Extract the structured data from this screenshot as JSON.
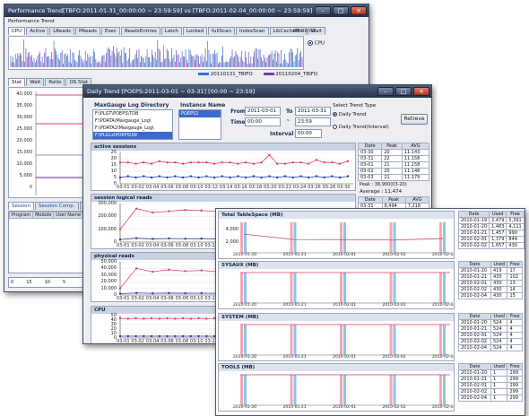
{
  "perf_window": {
    "title": "Performance Trend[TBFO:2011-01-31_00:00:00 ~ 23:59:59] vs [TBFO:2011-02-04_00:00:00 ~ 23:59:59]",
    "header_label": "Performance Trend",
    "tabs": [
      "CPU",
      "Active",
      "LReads",
      "PReads",
      "Exec",
      "ReadsEntries",
      "Latch",
      "Locked",
      "fullScan",
      "IndexScan",
      "LibCachePin",
      "Wait"
    ],
    "time_label": "00:00:00",
    "cpu_radio": "CPU",
    "legend": [
      "20110131_TBIFO",
      "20110204_TBIFO"
    ],
    "sub_tabs": [
      "Stat",
      "Wait",
      "Ratio",
      "OS Stat"
    ],
    "y_ticks": [
      "40,000",
      "35,000",
      "30,000",
      "25,000",
      "20,000",
      "15,000",
      "10,000",
      "5,000",
      "0"
    ],
    "session_tabs": [
      "Session",
      "Session Comp.",
      "Proce"
    ],
    "session_columns": [
      "Program",
      "Module",
      "User Name",
      "SPID"
    ],
    "bottom_values": [
      "0",
      "15",
      "10",
      "5"
    ]
  },
  "daily_window": {
    "title": "Daily Trend [POEPS:2011-03-01 ~ 03-31] [00:00 ~ 23:59]",
    "log_dir_label": "MaxGauge Log Directory",
    "log_dirs": [
      "F:\\PLGT\\POEPS\\TDB",
      "F:\\PDATA\\Maxgauge_Log\\",
      "F:\\PDATA2\\Maxgauge_Log\\",
      "F:\\PLGLs\\POEPS\\IW"
    ],
    "instance_label": "Instance Name",
    "instances": [
      "POEPS1"
    ],
    "from_label": "From",
    "from_date": "2011-03-01",
    "to_label": "To",
    "to_date": "2011-03-31",
    "time_label": "Time",
    "time_from": "00:00",
    "time_to": "23:59",
    "interval_label": "Interval",
    "interval_value": "00:00",
    "select_trend_label": "Select Trend Type",
    "trend_options": [
      "Daily Trend",
      "Daily Trend(Interval)"
    ],
    "retrieve_button": "Retreve",
    "charts": [
      {
        "title": "active sessions",
        "y_ticks": [
          "25",
          "20",
          "15",
          "10",
          "5",
          "0"
        ]
      },
      {
        "title": "session logical reads",
        "y_ticks": [
          "300,000",
          "200,000",
          "100,000",
          "0"
        ]
      },
      {
        "title": "physical reads",
        "y_ticks": [
          "50,000",
          "40,000",
          "30,000",
          "20,000",
          "10,000",
          "0"
        ]
      },
      {
        "title": "CPU",
        "y_ticks": [
          "50",
          "40",
          "30",
          "20",
          "10",
          "0"
        ]
      }
    ],
    "x_ticks": [
      "03-01",
      "03-02",
      "03-04",
      "03-06",
      "03-08",
      "03-10",
      "03-12",
      "03-14",
      "03-16",
      "03-18",
      "03-20",
      "03-22",
      "03-24",
      "03-26",
      "03-28",
      "03-30"
    ],
    "side_table": {
      "columns": [
        "Date",
        "Peak",
        "AVG"
      ],
      "rows": [
        [
          "03-30",
          "20",
          "11.143"
        ],
        [
          "03-31",
          "22",
          "11.158"
        ],
        [
          "03-01",
          "21",
          "11.158"
        ],
        [
          "03-02",
          "20",
          "11.148"
        ],
        [
          "03-03",
          "21",
          "11.179"
        ]
      ],
      "peak_note": "Peak : 38,900(03-20)",
      "average_note": "Average : 11,474",
      "rows2": [
        [
          "03-31",
          "8,494",
          "7,218"
        ]
      ]
    }
  },
  "tablespace_window": {
    "sections": [
      {
        "title": "Total TableSpace (MB)",
        "y_ticks": [
          "4,000",
          "2,000"
        ],
        "columns": [
          "Date",
          "Used",
          "Free"
        ],
        "rows": [
          [
            "2010-01-19",
            "2,479",
            "5,391"
          ],
          [
            "2010-01-20",
            "1,483",
            "4,111"
          ],
          [
            "2010-01-21",
            "1,457",
            "990"
          ],
          [
            "2010-02-01",
            "1,379",
            "849"
          ],
          [
            "2010-02-02",
            "1,657",
            "430"
          ]
        ]
      },
      {
        "title": "SYSAUX (MB)",
        "y_ticks": [],
        "columns": [
          "Date",
          "Used",
          "Free"
        ],
        "rows": [
          [
            "2010-01-20",
            "419",
            "17"
          ],
          [
            "2010-01-21",
            "430",
            "102"
          ],
          [
            "2010-02-01",
            "430",
            "13"
          ],
          [
            "2010-02-02",
            "430",
            "14"
          ],
          [
            "2010-02-04",
            "430",
            "15"
          ]
        ]
      },
      {
        "title": "SYSTEM (MB)",
        "y_ticks": [],
        "columns": [
          "Date",
          "Used",
          "Free"
        ],
        "rows": [
          [
            "2010-01-20",
            "524",
            "4"
          ],
          [
            "2010-01-21",
            "524",
            "4"
          ],
          [
            "2010-02-01",
            "524",
            "4"
          ],
          [
            "2010-02-02",
            "524",
            "4"
          ],
          [
            "2010-02-04",
            "524",
            "4"
          ]
        ]
      },
      {
        "title": "TOOLS (MB)",
        "y_ticks": [],
        "columns": [
          "Date",
          "Used",
          "Free"
        ],
        "rows": [
          [
            "2010-01-20",
            "1",
            "299"
          ],
          [
            "2010-01-21",
            "1",
            "299"
          ],
          [
            "2010-02-01",
            "1",
            "299"
          ],
          [
            "2010-02-02",
            "1",
            "299"
          ],
          [
            "2010-02-04",
            "1",
            "299"
          ]
        ]
      }
    ],
    "x_ticks": [
      "2010-01-20",
      "2010-01-21",
      "2010-02-01",
      "2010-02-02",
      "2010-02-04"
    ]
  },
  "colors": {
    "pink_series": "#e0406a",
    "blue_series": "#2838a0",
    "purple_series": "#5a2a9a",
    "bar_blue": "#8fc4ea",
    "bar_pink": "#f0a8b8",
    "titlebar": "#2e3b55"
  },
  "chart_data": [
    {
      "type": "line",
      "title": "active sessions",
      "x": [
        "03-01",
        "03-02",
        "03-03",
        "03-04",
        "03-05",
        "03-06",
        "03-07",
        "03-08",
        "03-09",
        "03-10",
        "03-11",
        "03-12",
        "03-13",
        "03-14",
        "03-15",
        "03-16",
        "03-17",
        "03-18",
        "03-19",
        "03-20",
        "03-21",
        "03-22",
        "03-23",
        "03-24",
        "03-25",
        "03-26",
        "03-27",
        "03-28",
        "03-29",
        "03-30"
      ],
      "series": [
        {
          "values": [
            17,
            17,
            16,
            17,
            16,
            18,
            17,
            17,
            16,
            17,
            17,
            17,
            16,
            17,
            17,
            16,
            17,
            16,
            17,
            23,
            16,
            16,
            17,
            17,
            16,
            19,
            17,
            17,
            16,
            18
          ]
        },
        {
          "values": [
            5,
            6,
            5,
            6,
            5,
            6,
            5,
            6,
            5,
            6,
            5,
            6,
            5,
            6,
            5,
            6,
            5,
            6,
            5,
            6,
            5,
            6,
            5,
            6,
            5,
            6,
            5,
            6,
            5,
            6
          ]
        }
      ],
      "ylim": [
        0,
        25
      ]
    },
    {
      "type": "line",
      "title": "session logical reads",
      "x": [
        "03-01",
        "03-02",
        "03-03",
        "03-04",
        "03-05",
        "03-06",
        "03-07",
        "03-08",
        "03-09",
        "03-10",
        "03-11",
        "03-12",
        "03-13",
        "03-14",
        "03-15"
      ],
      "series": [
        {
          "values": [
            100000,
            260000,
            230000,
            240000,
            250000,
            245000,
            240000,
            250000,
            240000,
            245000,
            240000,
            250000,
            245000,
            240000,
            250000
          ]
        },
        {
          "values": [
            20000,
            30000,
            25000,
            28000,
            26000,
            27000,
            25000,
            28000,
            26000,
            27000,
            25000,
            28000,
            26000,
            27000,
            25000
          ]
        }
      ],
      "ylim": [
        0,
        300000
      ]
    },
    {
      "type": "line",
      "title": "physical reads",
      "x": [
        "03-01",
        "03-02",
        "03-03",
        "03-04",
        "03-05",
        "03-06",
        "03-07",
        "03-08",
        "03-09",
        "03-10",
        "03-11",
        "03-12",
        "03-13",
        "03-14",
        "03-15"
      ],
      "series": [
        {
          "values": [
            10000,
            40000,
            35000,
            38000,
            36000,
            37000,
            35000,
            39000,
            36000,
            37000,
            35000,
            38000,
            36000,
            37000,
            35000
          ]
        },
        {
          "values": [
            2000,
            3000,
            2500,
            2800,
            2600,
            2700,
            2500,
            2800,
            2600,
            2700,
            2500,
            2800,
            2600,
            2700,
            2500
          ]
        }
      ],
      "ylim": [
        0,
        50000
      ]
    },
    {
      "type": "bar",
      "title": "Total TableSpace (MB)",
      "categories": [
        "2010-01-19",
        "2010-01-20",
        "2010-01-21",
        "2010-02-01",
        "2010-02-02"
      ],
      "series": [
        {
          "values": [
            2479,
            1483,
            1457,
            1379,
            1657
          ]
        },
        {
          "values": [
            5391,
            4111,
            990,
            849,
            430
          ]
        }
      ]
    }
  ]
}
